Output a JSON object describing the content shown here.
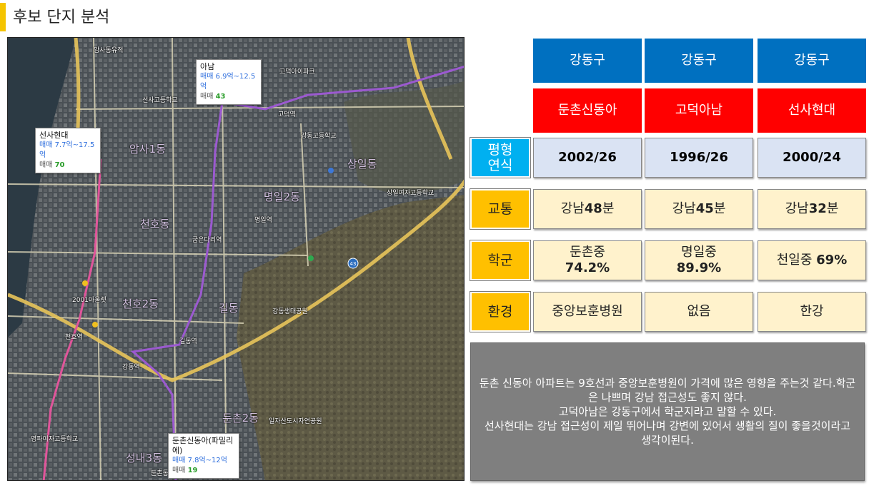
{
  "title": "후보 단지 분석",
  "map": {
    "callouts": [
      {
        "name": "아남",
        "price": "매매 6.9억~12.5억",
        "count_label": "매매",
        "count": "43"
      },
      {
        "name": "선사현대",
        "price": "매매 7.7억~17.5억",
        "count_label": "매매",
        "count": "70"
      },
      {
        "name": "둔촌신동아(파밀리에)",
        "price": "매매 7.8억~12억",
        "count_label": "매매",
        "count": "19"
      }
    ],
    "labels": [
      "암사1동",
      "상일동",
      "천호동",
      "명일2동",
      "길동",
      "둔촌2동",
      "성내3동",
      "천호2동",
      "암사동유적",
      "선사고등학교",
      "고덕역",
      "강동고등학교",
      "명일역",
      "굽은다리역",
      "길동역",
      "둔촌동역",
      "2001아울렛",
      "강동생태공원",
      "일자산도시자연공원",
      "천호역",
      "강동역",
      "영파여자고등학교",
      "상일여자고등학교",
      "고덕아이파크"
    ]
  },
  "table": {
    "districts": [
      "강동구",
      "강동구",
      "강동구"
    ],
    "complexes": [
      "둔촌신동아",
      "고덕아남",
      "선사현대"
    ],
    "rows": [
      {
        "label": "평형\n연식",
        "values": [
          "2002/26",
          "1996/26",
          "2000/24"
        ]
      },
      {
        "label": "교통",
        "values": [
          {
            "pre": "강남",
            "num": "48",
            "post": "분"
          },
          {
            "pre": "강남",
            "num": "45",
            "post": "분"
          },
          {
            "pre": "강남",
            "num": "32",
            "post": "분"
          }
        ]
      },
      {
        "label": "학군",
        "values": [
          {
            "school": "둔촌중",
            "pct": "74.2%"
          },
          {
            "school": "명일중",
            "pct": "89.9%"
          },
          {
            "school": "천일중",
            "pct": "69%"
          }
        ]
      },
      {
        "label": "환경",
        "values": [
          "중앙보훈병원",
          "없음",
          "한강"
        ]
      }
    ]
  },
  "summary": [
    "둔촌 신동아 아파트는 9호선과 중앙보훈병원이 가격에 많은 영향을 주는것 같다.학군은 나쁘며 강남 접근성도 좋지 않다.",
    "고덕아남은 강동구에서 학군지라고 말할 수 있다.",
    "선사현대는 강남 접근성이 제일 뛰어나며 강변에 있어서 생활의 질이 좋을것이라고 생각이된다."
  ],
  "colors": {
    "accent_title": "#f5c400",
    "district_blue": "#0070c0",
    "complex_red": "#ff0000",
    "label_cyan": "#00b0f0",
    "label_gold": "#ffc000",
    "cell_lavender": "#dae3f3",
    "cell_cream": "#fff2cc",
    "summary_gray": "#7f7f7f",
    "metro_line_9": "#9b59d0",
    "metro_line_5": "#e0559a"
  }
}
